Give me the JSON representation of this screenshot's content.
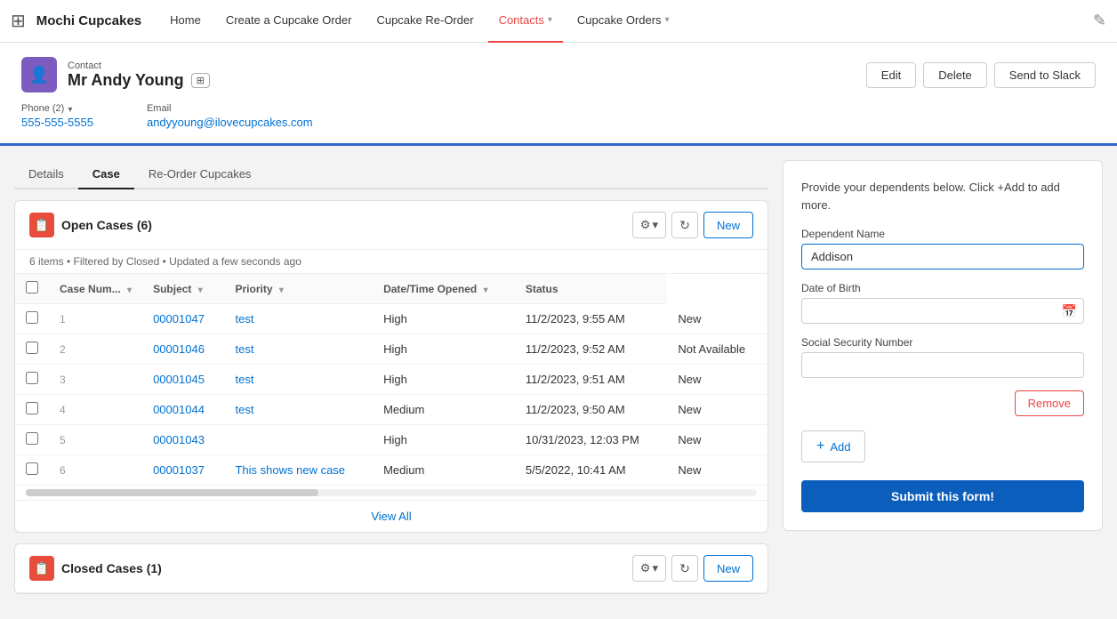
{
  "app": {
    "name": "Mochi Cupcakes",
    "nav_items": [
      {
        "label": "Home",
        "active": false,
        "has_chevron": false
      },
      {
        "label": "Create a Cupcake Order",
        "active": false,
        "has_chevron": false
      },
      {
        "label": "Cupcake Re-Order",
        "active": false,
        "has_chevron": false
      },
      {
        "label": "Contacts",
        "active": true,
        "has_chevron": true
      },
      {
        "label": "Cupcake Orders",
        "active": false,
        "has_chevron": true
      }
    ]
  },
  "contact": {
    "label": "Contact",
    "name": "Mr Andy Young",
    "badge_title": "partner icon",
    "buttons": {
      "edit": "Edit",
      "delete": "Delete",
      "send_to_slack": "Send to Slack"
    },
    "phone_label": "Phone (2)",
    "phone_value": "555-555-5555",
    "email_label": "Email",
    "email_value": "andyyoung@ilovecupcakes.com"
  },
  "tabs": [
    {
      "label": "Details",
      "active": false
    },
    {
      "label": "Case",
      "active": true
    },
    {
      "label": "Re-Order Cupcakes",
      "active": false
    }
  ],
  "open_cases": {
    "icon": "📋",
    "title": "Open Cases (6)",
    "meta": "6 items • Filtered by Closed • Updated a few seconds ago",
    "columns": [
      "Case Num...",
      "Subject",
      "Priority",
      "Date/Time Opened",
      "Status"
    ],
    "new_label": "New",
    "view_all_label": "View All",
    "rows": [
      {
        "num": 1,
        "case_num": "00001047",
        "subject": "test",
        "priority": "High",
        "datetime": "11/2/2023, 9:55 AM",
        "status": "New"
      },
      {
        "num": 2,
        "case_num": "00001046",
        "subject": "test",
        "priority": "High",
        "datetime": "11/2/2023, 9:52 AM",
        "status": "Not Available"
      },
      {
        "num": 3,
        "case_num": "00001045",
        "subject": "test",
        "priority": "High",
        "datetime": "11/2/2023, 9:51 AM",
        "status": "New"
      },
      {
        "num": 4,
        "case_num": "00001044",
        "subject": "test",
        "priority": "Medium",
        "datetime": "11/2/2023, 9:50 AM",
        "status": "New"
      },
      {
        "num": 5,
        "case_num": "00001043",
        "subject": "",
        "priority": "High",
        "datetime": "10/31/2023, 12:03 PM",
        "status": "New"
      },
      {
        "num": 6,
        "case_num": "00001037",
        "subject": "This shows new case",
        "priority": "Medium",
        "datetime": "5/5/2022, 10:41 AM",
        "status": "New"
      }
    ]
  },
  "closed_cases": {
    "title": "Closed Cases (1)",
    "new_label": "New"
  },
  "right_panel": {
    "description": "Provide your dependents below. Click +Add to add more.",
    "fields": {
      "dependent_name_label": "Dependent Name",
      "dependent_name_value": "Addison",
      "date_of_birth_label": "Date of Birth",
      "date_of_birth_value": "",
      "ssn_label": "Social Security Number",
      "ssn_value": ""
    },
    "remove_label": "Remove",
    "add_label": "Add",
    "submit_label": "Submit this form!"
  }
}
